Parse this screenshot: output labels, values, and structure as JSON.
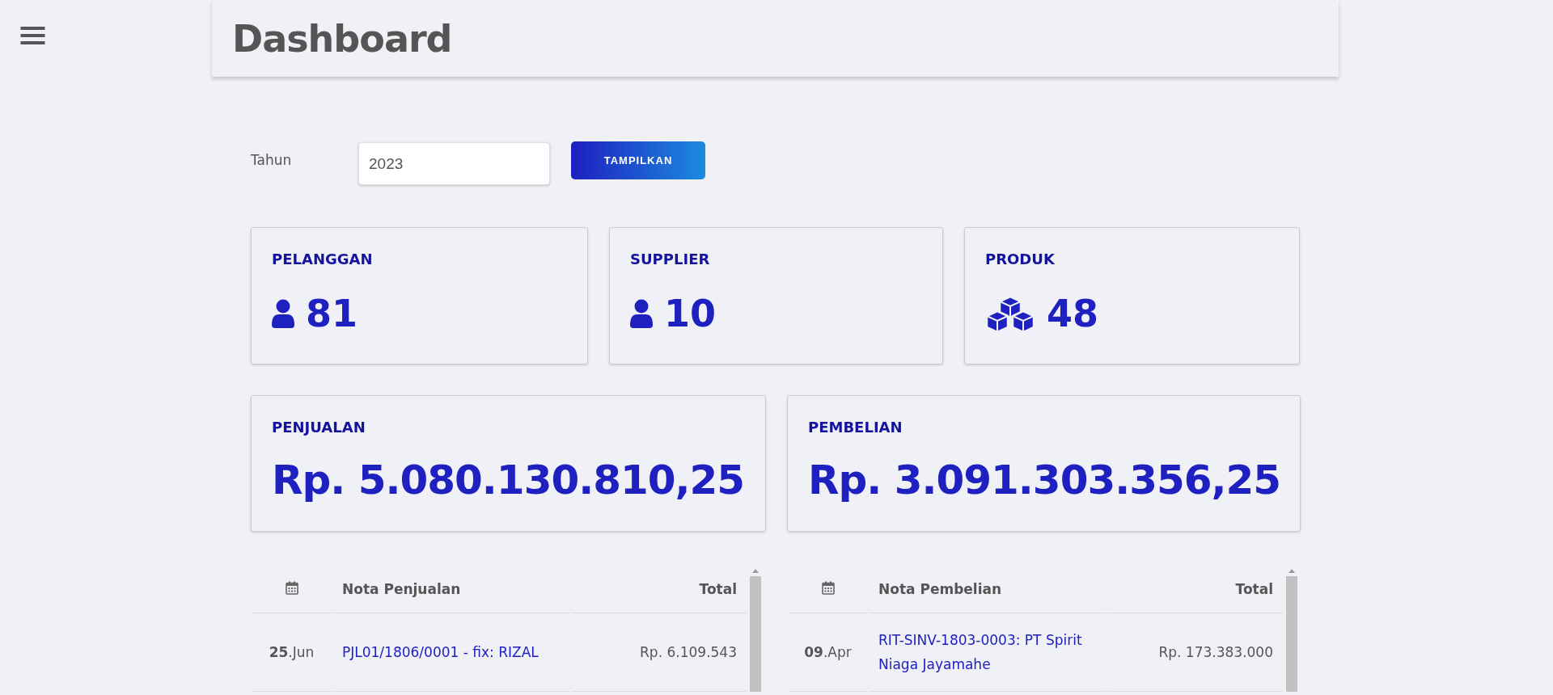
{
  "header": {
    "title": "Dashboard"
  },
  "filter": {
    "label": "Tahun",
    "value": "2023",
    "button": "TAMPILKAN"
  },
  "stats": [
    {
      "label": "PELANGGAN",
      "kind": "person",
      "value": "81"
    },
    {
      "label": "SUPPLIER",
      "kind": "person",
      "value": "10"
    },
    {
      "label": "PRODUK",
      "kind": "boxes",
      "value": "48"
    }
  ],
  "totals": [
    {
      "label": "PENJUALAN",
      "value": "Rp. 5.080.130.810,25"
    },
    {
      "label": "PEMBELIAN",
      "value": "Rp. 3.091.303.356,25"
    }
  ],
  "tables": [
    {
      "columns": [
        "Nota Penjualan",
        "Total"
      ],
      "rows": [
        {
          "date": "**25**.Jun",
          "nota": "PJL01/1806/0001 - fix: RIZAL",
          "total": "Rp. 6.109.543"
        }
      ]
    },
    {
      "columns": [
        "Nota Pembelian",
        "Total"
      ],
      "rows": [
        {
          "date": "**09**.Apr",
          "nota": "RIT-SINV-1803-0003: PT Spirit Niaga Jayamahe",
          "total": "Rp. 173.383.000"
        }
      ]
    }
  ]
}
